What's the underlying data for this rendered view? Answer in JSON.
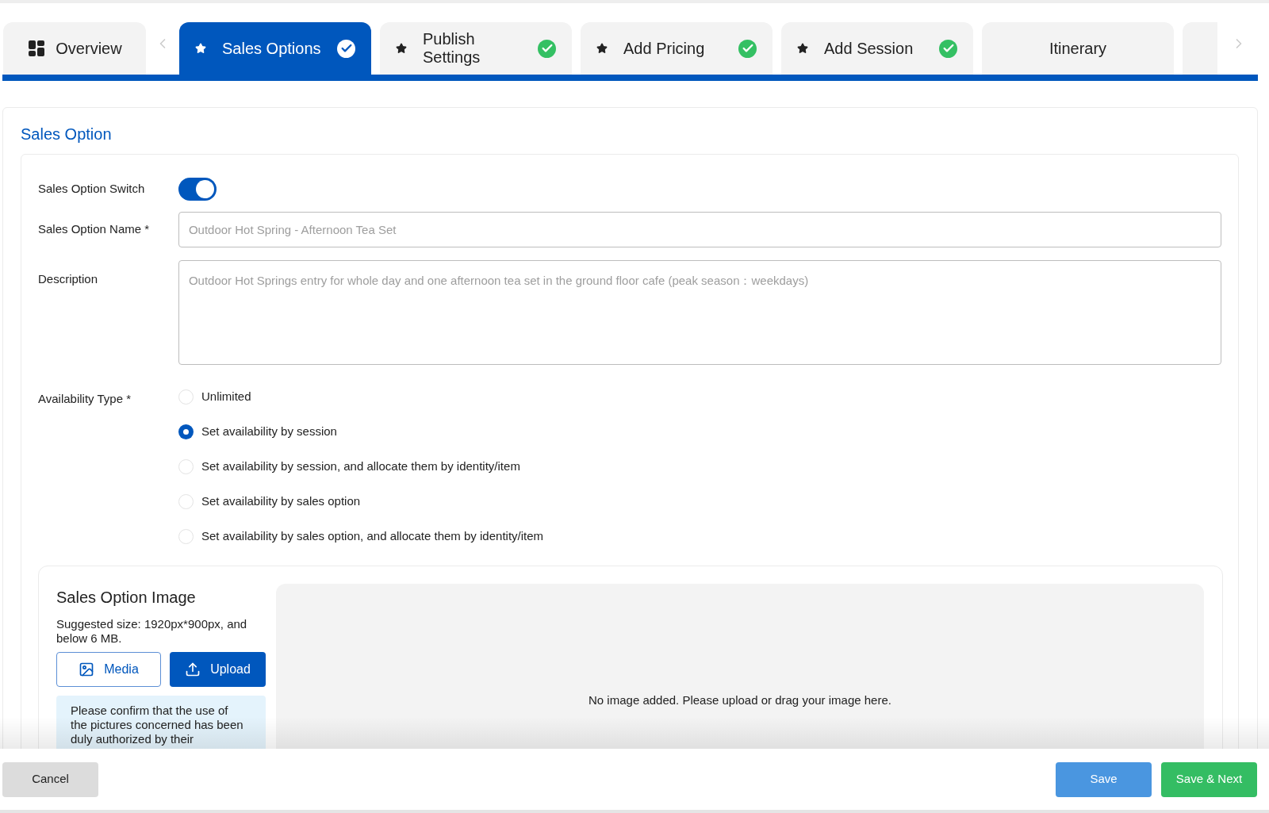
{
  "tabs": [
    {
      "kind": "overview",
      "label": "Overview",
      "starred": false,
      "completed": false,
      "selected": false
    },
    {
      "kind": "step",
      "label": "Sales Options",
      "starred": true,
      "completed": true,
      "selected": true
    },
    {
      "kind": "step",
      "label": "Publish Settings",
      "starred": true,
      "completed": true,
      "selected": false
    },
    {
      "kind": "step",
      "label": "Add Pricing",
      "starred": true,
      "completed": true,
      "selected": false
    },
    {
      "kind": "step",
      "label": "Add Session",
      "starred": true,
      "completed": true,
      "selected": false
    },
    {
      "kind": "step",
      "label": "Itinerary",
      "starred": false,
      "completed": false,
      "selected": false
    }
  ],
  "section": {
    "title": "Sales Option"
  },
  "form": {
    "switch": {
      "label": "Sales Option Switch",
      "on": true
    },
    "name": {
      "label": "Sales Option Name *",
      "placeholder": "Outdoor Hot Spring - Afternoon Tea Set"
    },
    "description": {
      "label": "Description",
      "placeholder": "Outdoor Hot Springs entry for whole day and one afternoon tea set in the ground floor cafe (peak season：weekdays)"
    },
    "availability": {
      "label": "Availability Type *",
      "options": [
        {
          "label": "Unlimited",
          "selected": false
        },
        {
          "label": "Set availability by session",
          "selected": true
        },
        {
          "label": "Set availability by session, and allocate them by identity/item",
          "selected": false
        },
        {
          "label": "Set availability by sales option",
          "selected": false
        },
        {
          "label": "Set availability by sales option, and allocate them by identity/item",
          "selected": false
        }
      ]
    }
  },
  "image": {
    "title": "Sales Option Image",
    "hint": "Suggested size: 1920px*900px, and below 6 MB.",
    "media_button": "Media",
    "upload_button": "Upload",
    "notice": "Please confirm that the use of the pictures concerned has been duly authorized by their",
    "empty_text": "No image added. Please upload or drag your image here."
  },
  "footer": {
    "cancel": "Cancel",
    "save": "Save",
    "save_next": "Save & Next"
  }
}
